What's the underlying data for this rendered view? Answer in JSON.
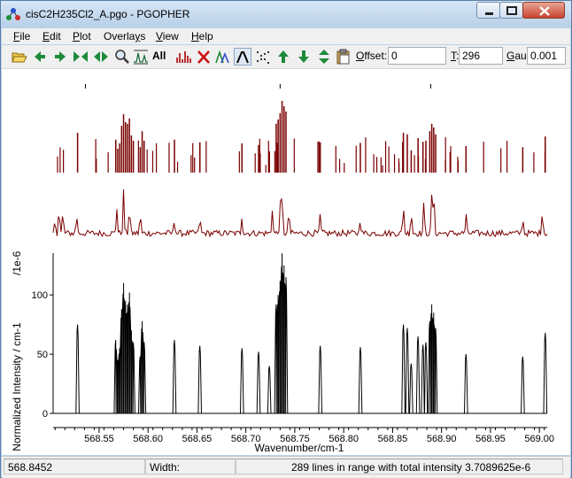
{
  "window": {
    "title": "cisC2H235Cl2_A.pgo - PGOPHER"
  },
  "menu": [
    {
      "pre": "",
      "acc": "F",
      "post": "ile"
    },
    {
      "pre": "",
      "acc": "E",
      "post": "dit"
    },
    {
      "pre": "",
      "acc": "P",
      "post": "lot"
    },
    {
      "pre": "Overla",
      "acc": "y",
      "post": "s"
    },
    {
      "pre": "",
      "acc": "V",
      "post": "iew"
    },
    {
      "pre": "",
      "acc": "H",
      "post": "elp"
    }
  ],
  "toolbar": {
    "all_label": "All",
    "offset": {
      "pre": "",
      "acc": "O",
      "post": "ffset:",
      "value": "0"
    },
    "temperature": {
      "pre": "",
      "acc": "T",
      "post": ":",
      "value": "296"
    },
    "gaussian": {
      "pre": "",
      "acc": "G",
      "post": "au:",
      "value": "0.001"
    }
  },
  "plot": {
    "colors": {
      "simulation": "#7a0000",
      "experiment": "#7a0000",
      "lines": "#000000",
      "axes": "#000000"
    }
  },
  "chart_data": {
    "type": "line",
    "xlabel": "Wavenumber/cm-1",
    "ylabel": "Normalized Intensity / cm-1",
    "y_multiplier_label": "/1e-6",
    "xlim": [
      568.503,
      569.008
    ],
    "ylim": [
      0,
      136
    ],
    "x_ticks": [
      568.55,
      568.6,
      568.65,
      568.7,
      568.75,
      568.8,
      568.85,
      568.9,
      568.95,
      569.0
    ],
    "x_tick_labels": [
      "568.55",
      "568.60",
      "568.65",
      "568.70",
      "568.75",
      "568.80",
      "568.85",
      "568.90",
      "568.95",
      "569.00"
    ],
    "y_ticks": [
      0,
      50,
      100
    ],
    "y_tick_labels": [
      "0",
      "50",
      "100"
    ],
    "markers": [
      568.536,
      568.735,
      568.889
    ],
    "series": [
      {
        "role": "spectrum",
        "peaks": [
          [
            568.528,
            75
          ],
          [
            568.567,
            62
          ],
          [
            568.569,
            45
          ],
          [
            568.571,
            55
          ],
          [
            568.573,
            88
          ],
          [
            568.575,
            110
          ],
          [
            568.577,
            95
          ],
          [
            568.579,
            92
          ],
          [
            568.581,
            102
          ],
          [
            568.583,
            70
          ],
          [
            568.585,
            60
          ],
          [
            568.592,
            48
          ],
          [
            568.594,
            78
          ],
          [
            568.596,
            60
          ],
          [
            568.627,
            62
          ],
          [
            568.653,
            57
          ],
          [
            568.696,
            55
          ],
          [
            568.713,
            52
          ],
          [
            568.724,
            40
          ],
          [
            568.731,
            92
          ],
          [
            568.733,
            100
          ],
          [
            568.735,
            112
          ],
          [
            568.737,
            135
          ],
          [
            568.739,
            125
          ],
          [
            568.741,
            115
          ],
          [
            568.776,
            57
          ],
          [
            568.817,
            56
          ],
          [
            568.861,
            75
          ],
          [
            568.865,
            72
          ],
          [
            568.869,
            42
          ],
          [
            568.876,
            65
          ],
          [
            568.881,
            58
          ],
          [
            568.884,
            60
          ],
          [
            568.888,
            78
          ],
          [
            568.89,
            92
          ],
          [
            568.892,
            85
          ],
          [
            568.894,
            72
          ],
          [
            568.925,
            50
          ],
          [
            568.983,
            48
          ],
          [
            569.006,
            68
          ]
        ]
      },
      {
        "role": "experiment",
        "peaks": [
          [
            568.505,
            14
          ],
          [
            568.509,
            31
          ],
          [
            568.513,
            24
          ],
          [
            568.527,
            22
          ],
          [
            568.568,
            30
          ],
          [
            568.575,
            47
          ],
          [
            568.581,
            32
          ],
          [
            568.592,
            22
          ],
          [
            568.627,
            17
          ],
          [
            568.653,
            18
          ],
          [
            568.696,
            20
          ],
          [
            568.727,
            28
          ],
          [
            568.735,
            32
          ],
          [
            568.737,
            48
          ],
          [
            568.744,
            26
          ],
          [
            568.776,
            20
          ],
          [
            568.817,
            18
          ],
          [
            568.861,
            33
          ],
          [
            568.869,
            26
          ],
          [
            568.882,
            34
          ],
          [
            568.89,
            42
          ],
          [
            568.892,
            48
          ],
          [
            568.925,
            20
          ],
          [
            568.983,
            18
          ],
          [
            569.003,
            28
          ]
        ]
      }
    ]
  },
  "status": {
    "position": "568.8452",
    "width_label": "Width:",
    "message": "289 lines in range with total intensity 3.7089625e-6"
  }
}
